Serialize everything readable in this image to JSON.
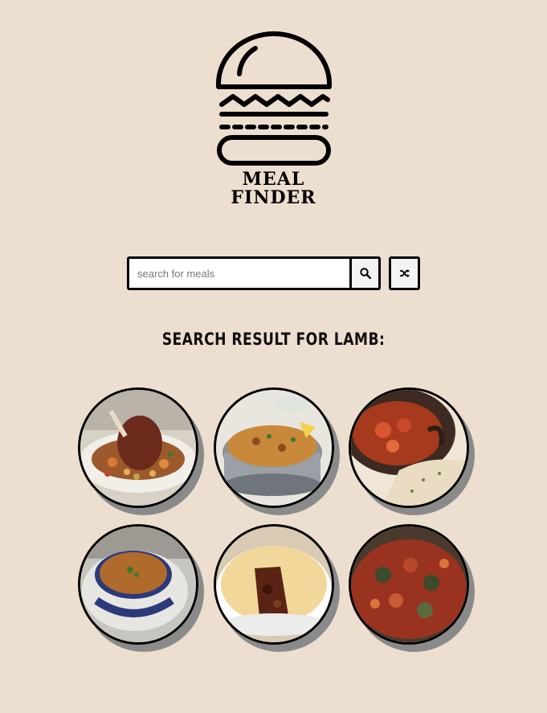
{
  "brand": {
    "line1": "MEAL",
    "line2": "FINDER",
    "logo_icon": "burger-icon"
  },
  "search": {
    "placeholder": "search for meals",
    "value": "",
    "search_icon": "search-icon",
    "random_icon": "shuffle-icon"
  },
  "results": {
    "heading": "SEARCH RESULT FOR LAMB:",
    "meals": [
      {
        "image": "lamb-shank-with-chickpeas"
      },
      {
        "image": "lamb-biryani-in-pot"
      },
      {
        "image": "lamb-tagine-with-rice"
      },
      {
        "image": "lamb-soup-in-tureen"
      },
      {
        "image": "lamb-pie"
      },
      {
        "image": "lamb-stew-with-vegetables"
      }
    ]
  },
  "colors": {
    "background": "#eddfcf",
    "border": "#000000",
    "shadow": "#8a8a8a"
  }
}
